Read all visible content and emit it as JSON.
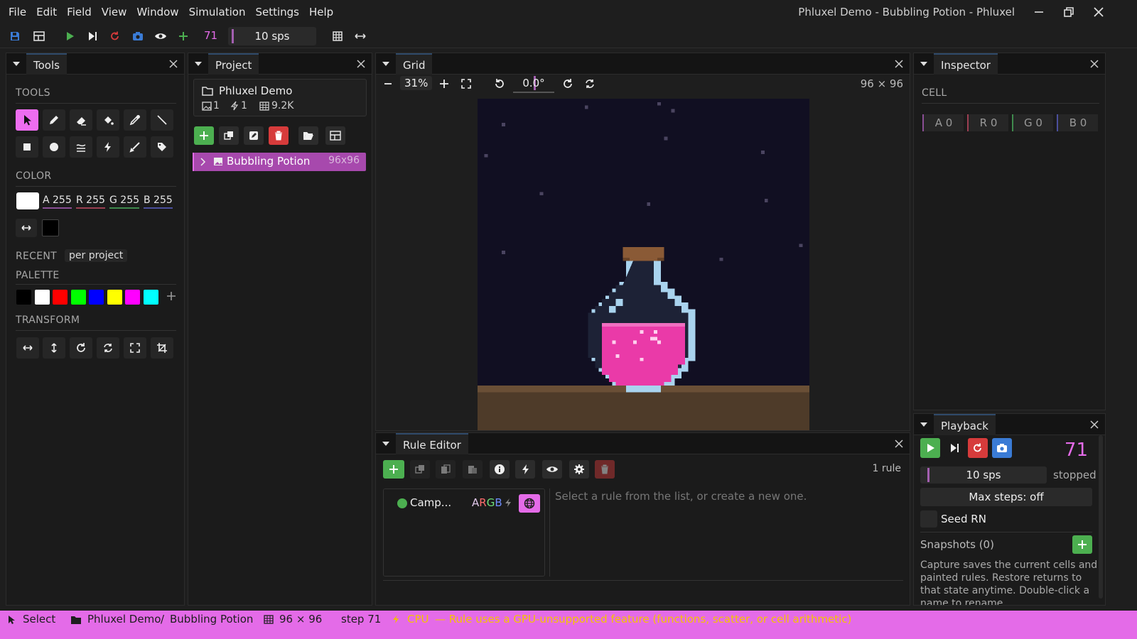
{
  "menus": [
    "File",
    "Edit",
    "Field",
    "View",
    "Window",
    "Simulation",
    "Settings",
    "Help"
  ],
  "window_title": "Phluxel Demo - Bubbling Potion - Phluxel",
  "toolbar": {
    "step": "71",
    "speed": "10 sps"
  },
  "tools_panel": {
    "title": "Tools",
    "tools_label": "TOOLS",
    "color_label": "COLOR",
    "color": {
      "a": "A 255",
      "r": "R 255",
      "g": "G 255",
      "b": "B 255"
    },
    "recent_label": "RECENT",
    "recent_scope": "per project",
    "palette_label": "PALETTE",
    "palette": [
      "#000000",
      "#ffffff",
      "#ff0000",
      "#00ff00",
      "#0000ff",
      "#ffff00",
      "#ff00ff",
      "#00ffff"
    ],
    "transform_label": "TRANSFORM"
  },
  "project_panel": {
    "title": "Project",
    "project_name": "Phluxel Demo",
    "stats": {
      "images": "1",
      "rules": "1",
      "cells": "9.2K"
    },
    "item": {
      "name": "Bubbling Potion",
      "size": "96x96"
    }
  },
  "grid_panel": {
    "title": "Grid",
    "zoom": "31%",
    "rotation": "0.0°",
    "dims": "96 × 96"
  },
  "inspector_panel": {
    "title": "Inspector",
    "cell_label": "CELL",
    "cell": {
      "a": "A 0",
      "r": "R 0",
      "g": "G 0",
      "b": "B 0"
    }
  },
  "rule_editor": {
    "title": "Rule Editor",
    "rule_count": "1 rule",
    "rule": {
      "name": "Camp...",
      "channels": [
        "A",
        "R",
        "G",
        "B"
      ]
    },
    "placeholder": "Select a rule from the list, or create a new one."
  },
  "playback": {
    "title": "Playback",
    "step": "71",
    "speed": "10 sps",
    "state": "stopped",
    "max_steps": "Max steps: off",
    "seed": "Seed RN",
    "snapshots": "Snapshots (0)",
    "help": "Capture saves the current cells and painted rules. Restore returns to that state anytime. Double-click a name to rename."
  },
  "status": {
    "tool": "Select",
    "project": "Phluxel Demo",
    "sep": "/",
    "field": "Bubbling Potion",
    "dims": "96 × 96",
    "step": "step 71",
    "backend": "CPU",
    "message": "— Rule uses a GPU-unsupported feature (functions, scatter, or cell arithmetic)"
  },
  "colors": {
    "accent": "#e46be8",
    "green": "#4caf50",
    "red": "#d63b3b",
    "blue": "#3a7bd5",
    "potion": "#ea3aa8"
  }
}
